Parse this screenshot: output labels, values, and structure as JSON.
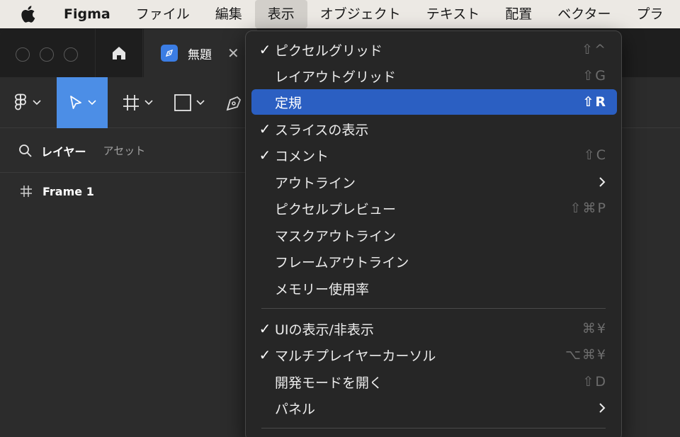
{
  "menubar": {
    "app_name": "Figma",
    "items": [
      "ファイル",
      "編集",
      "表示",
      "オブジェクト",
      "テキスト",
      "配置",
      "ベクター",
      "プラ"
    ],
    "active_index": 2
  },
  "window": {
    "tab_title": "無題",
    "close_glyph": "✕"
  },
  "panel": {
    "layers_tab": "レイヤー",
    "assets_tab": "アセット",
    "layer_name": "Frame 1",
    "frame_glyph": "#"
  },
  "menu": {
    "items": [
      {
        "label": "ピクセルグリッド",
        "checked": true,
        "shortcut": "⇧^"
      },
      {
        "label": "レイアウトグリッド",
        "checked": false,
        "shortcut": "⇧G"
      },
      {
        "label": "定規",
        "checked": false,
        "shortcut": "⇧R",
        "highlighted": true
      },
      {
        "label": "スライスの表示",
        "checked": true,
        "shortcut": ""
      },
      {
        "label": "コメント",
        "checked": true,
        "shortcut": "⇧C"
      },
      {
        "label": "アウトライン",
        "checked": false,
        "submenu": true
      },
      {
        "label": "ピクセルプレビュー",
        "checked": false,
        "shortcut": "⇧⌘P"
      },
      {
        "label": "マスクアウトライン",
        "checked": false,
        "shortcut": ""
      },
      {
        "label": "フレームアウトライン",
        "checked": false,
        "shortcut": ""
      },
      {
        "label": "メモリー使用率",
        "checked": false,
        "shortcut": ""
      },
      {
        "label": "UIの表示/非表示",
        "checked": true,
        "shortcut": "⌘¥"
      },
      {
        "label": "マルチプレイヤーカーソル",
        "checked": true,
        "shortcut": "⌥⌘¥"
      },
      {
        "label": "開発モードを開く",
        "checked": false,
        "shortcut": "⇧D"
      },
      {
        "label": "パネル",
        "checked": false,
        "submenu": true
      }
    ],
    "check_glyph": "✓"
  },
  "colors": {
    "highlight": "#2b5fc2",
    "selected_tool": "#4c8ee6",
    "file_icon": "#3b7de4"
  }
}
